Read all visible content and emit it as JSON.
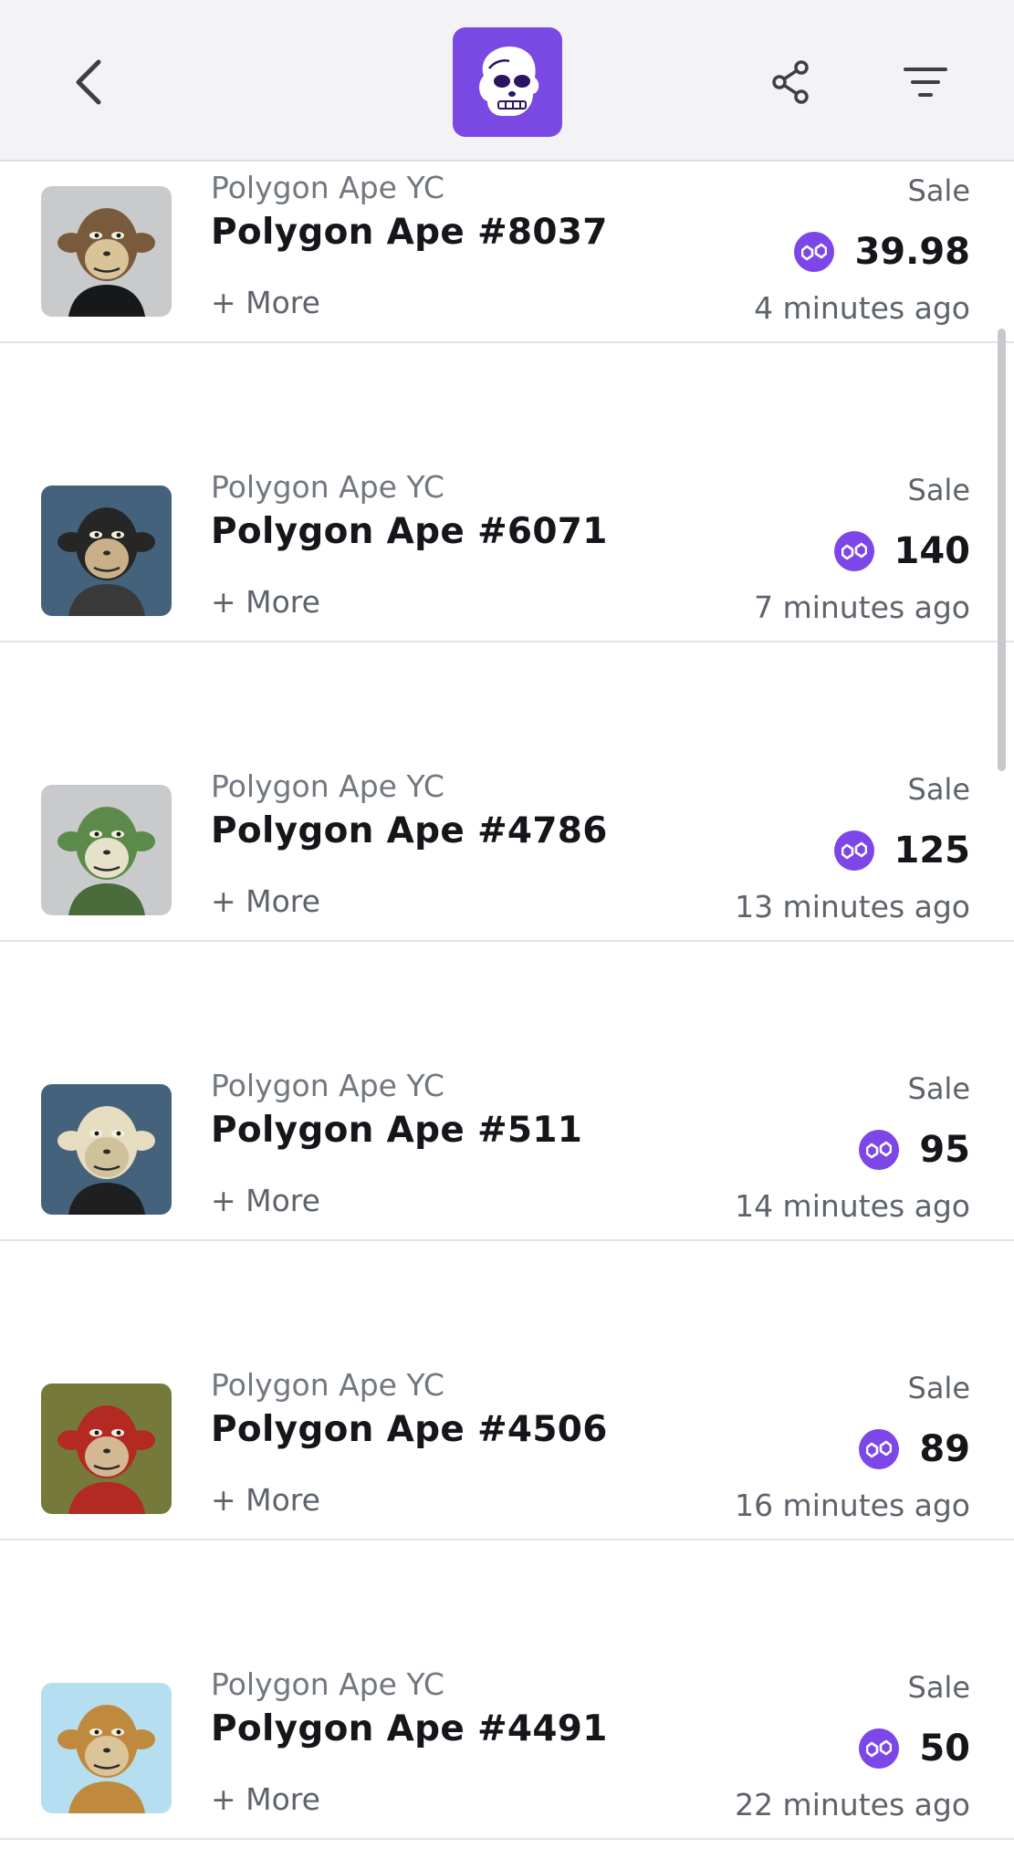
{
  "header": {
    "back_icon": "chevron-left-icon",
    "logo_icon": "ape-skull-logo",
    "share_icon": "share-icon",
    "filter_icon": "filter-icon"
  },
  "items": [
    {
      "collection": "Polygon Ape YC",
      "title": "Polygon Ape #8037",
      "more": "+ More",
      "type": "Sale",
      "price": "39.98",
      "time": "4 minutes ago",
      "bg": "#c9cacc",
      "fur": "#7a5a3c",
      "face": "#d9c49a",
      "outfit": "#16181a"
    },
    {
      "collection": "Polygon Ape YC",
      "title": "Polygon Ape #6071",
      "more": "+ More",
      "type": "Sale",
      "price": "140",
      "time": "7 minutes ago",
      "bg": "#45627c",
      "fur": "#262626",
      "face": "#c9b088",
      "outfit": "#3a3a3a"
    },
    {
      "collection": "Polygon Ape YC",
      "title": "Polygon Ape #4786",
      "more": "+ More",
      "type": "Sale",
      "price": "125",
      "time": "13 minutes ago",
      "bg": "#c9cacc",
      "fur": "#5b8a4a",
      "face": "#e6e1c8",
      "outfit": "#4a6b3a"
    },
    {
      "collection": "Polygon Ape YC",
      "title": "Polygon Ape #511",
      "more": "+ More",
      "type": "Sale",
      "price": "95",
      "time": "14 minutes ago",
      "bg": "#45627c",
      "fur": "#e6dcc0",
      "face": "#cfc19a",
      "outfit": "#1f1f1f"
    },
    {
      "collection": "Polygon Ape YC",
      "title": "Polygon Ape #4506",
      "more": "+ More",
      "type": "Sale",
      "price": "89",
      "time": "16 minutes ago",
      "bg": "#757a3a",
      "fur": "#b32a22",
      "face": "#d4b894",
      "outfit": "#b32a22"
    },
    {
      "collection": "Polygon Ape YC",
      "title": "Polygon Ape #4491",
      "more": "+ More",
      "type": "Sale",
      "price": "50",
      "time": "22 minutes ago",
      "bg": "#b5dff0",
      "fur": "#c08a3e",
      "face": "#dcc49a",
      "outfit": "#c08a3e"
    }
  ],
  "colors": {
    "accent": "#7a48e3",
    "text_primary": "#14161a",
    "text_secondary": "#727780"
  }
}
